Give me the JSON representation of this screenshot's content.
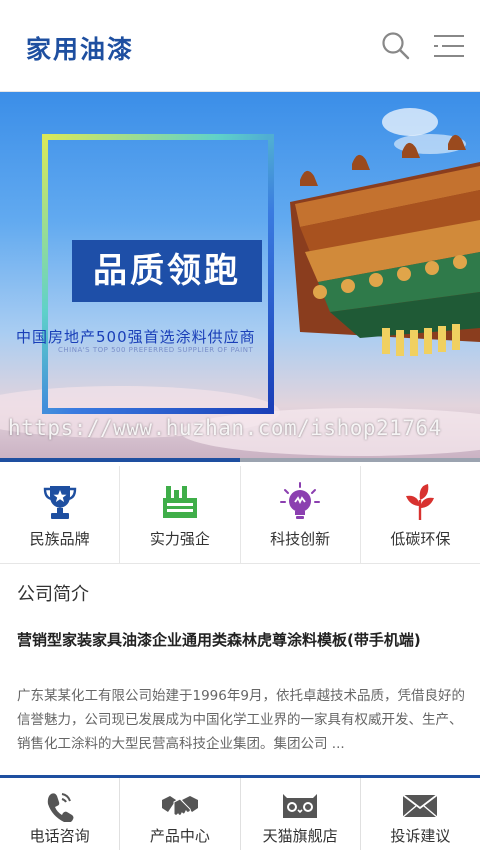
{
  "header": {
    "logo_text": "家用油漆"
  },
  "banner": {
    "headline": "品质领跑",
    "subline_cn": "中国房地产500强首选涂料供应商",
    "subline_en": "CHINA'S TOP 500 PREFERRED SUPPLIER OF PAINT",
    "watermark": "https://www.huzhan.com/ishop21764",
    "slide_progress": 0.5
  },
  "features": [
    {
      "label": "民族品牌",
      "icon": "trophy-icon",
      "color": "#1e4fa0"
    },
    {
      "label": "实力强企",
      "icon": "factory-icon",
      "color": "#3fae49"
    },
    {
      "label": "科技创新",
      "icon": "lightbulb-icon",
      "color": "#8b3fb0"
    },
    {
      "label": "低碳环保",
      "icon": "sprout-icon",
      "color": "#d8322f"
    }
  ],
  "about": {
    "title": "公司简介",
    "headline": "营销型家装家具油漆企业通用类森林虎尊涂料模板(带手机端)",
    "text": "广东某某化工有限公司始建于1996年9月，依托卓越技术品质，凭借良好的信誉魅力，公司现已发展成为中国化学工业界的一家具有权威开发、生产、销售化工涂料的大型民营高科技企业集团。集团公司 ..."
  },
  "bottom_nav": [
    {
      "label": "电话咨询",
      "icon": "phone-icon"
    },
    {
      "label": "产品中心",
      "icon": "handshake-icon"
    },
    {
      "label": "天猫旗舰店",
      "icon": "tmall-icon"
    },
    {
      "label": "投诉建议",
      "icon": "mail-icon"
    }
  ],
  "colors": {
    "brand": "#1e4fa0",
    "border": "#e6e6e6"
  }
}
